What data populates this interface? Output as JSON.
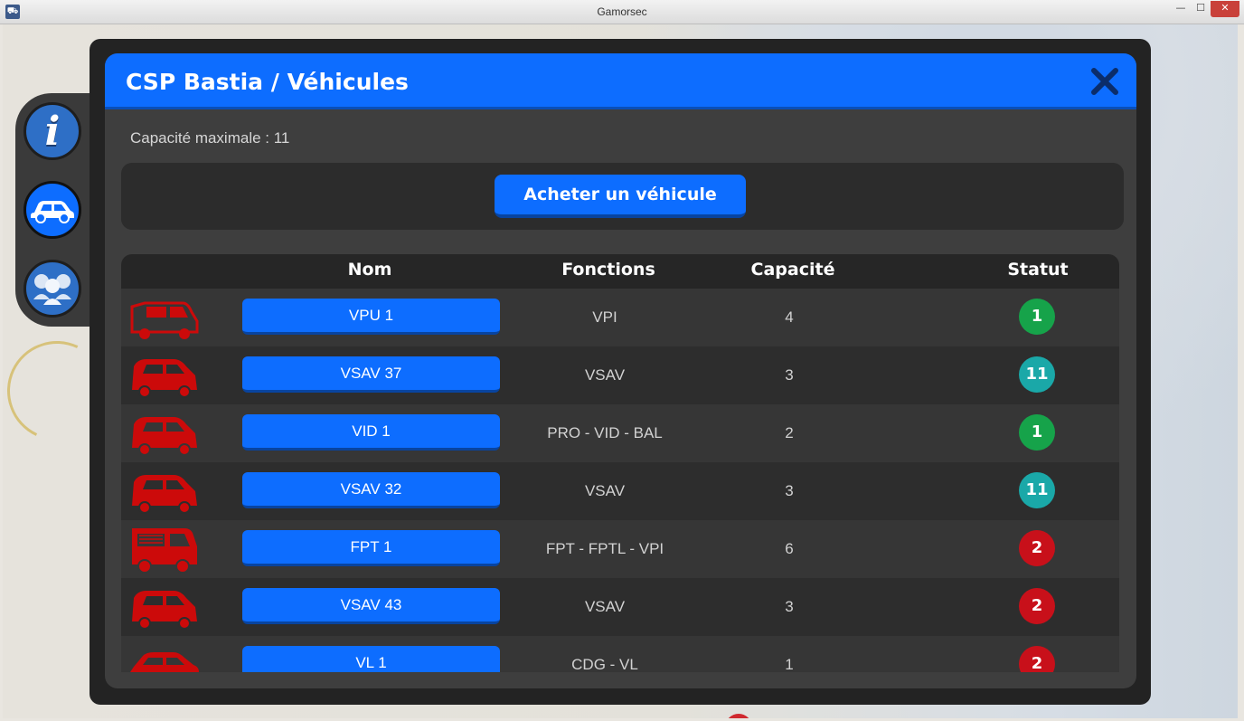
{
  "window": {
    "title": "Gamorsec"
  },
  "dialog": {
    "title": "CSP Bastia / Véhicules",
    "capacity_label": "Capacité maximale : 11",
    "buy_button": "Acheter un véhicule"
  },
  "table": {
    "headers": {
      "nom": "Nom",
      "fonctions": "Fonctions",
      "capacite": "Capacité",
      "statut": "Statut"
    },
    "rows": [
      {
        "vehicle_type": "van-icon",
        "name": "VPU 1",
        "fonctions": "VPI",
        "capacite": "4",
        "statut": "1",
        "status_color": "#16a34a"
      },
      {
        "vehicle_type": "ambulance-icon",
        "name": "VSAV 37",
        "fonctions": "VSAV",
        "capacite": "3",
        "statut": "11",
        "status_color": "#1aa8a8"
      },
      {
        "vehicle_type": "ambulance-icon",
        "name": "VID 1",
        "fonctions": "PRO - VID - BAL",
        "capacite": "2",
        "statut": "1",
        "status_color": "#16a34a"
      },
      {
        "vehicle_type": "ambulance-icon",
        "name": "VSAV 32",
        "fonctions": "VSAV",
        "capacite": "3",
        "statut": "11",
        "status_color": "#1aa8a8"
      },
      {
        "vehicle_type": "fire-truck-icon",
        "name": "FPT 1",
        "fonctions": "FPT - FPTL - VPI",
        "capacite": "6",
        "statut": "2",
        "status_color": "#c8101a"
      },
      {
        "vehicle_type": "ambulance-icon",
        "name": "VSAV 43",
        "fonctions": "VSAV",
        "capacite": "3",
        "statut": "2",
        "status_color": "#c8101a"
      },
      {
        "vehicle_type": "car-icon",
        "name": "VL 1",
        "fonctions": "CDG - VL",
        "capacite": "1",
        "statut": "2",
        "status_color": "#c8101a"
      }
    ]
  },
  "colors": {
    "accent": "#0d6dff",
    "vehicle_icon": "#cc0a0a"
  }
}
